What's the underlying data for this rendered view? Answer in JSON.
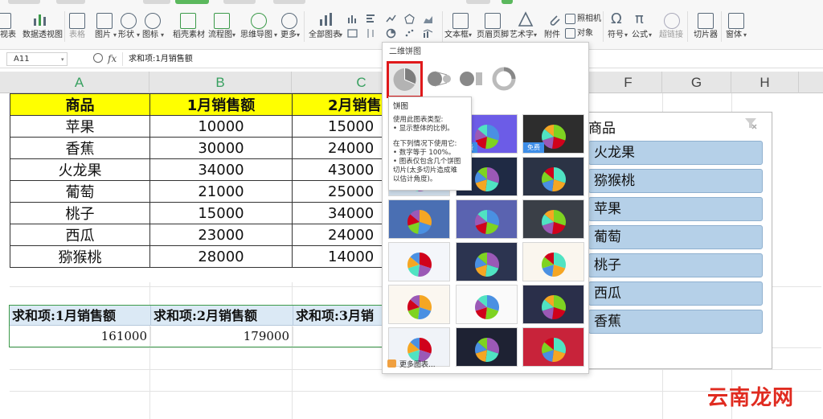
{
  "ribbon": {
    "tools": [
      {
        "label": "视表",
        "icon": "pivot-icon"
      },
      {
        "label": "数据透视图",
        "icon": "pivot-chart-icon"
      },
      {
        "label": "表格",
        "icon": "table-icon"
      },
      {
        "label": "图片",
        "icon": "picture-icon"
      },
      {
        "label": "形状",
        "icon": "shape-icon"
      },
      {
        "label": "图标",
        "icon": "icon-library-icon"
      },
      {
        "label": "稻壳素材",
        "icon": "docer-icon"
      },
      {
        "label": "流程图",
        "icon": "flowchart-icon"
      },
      {
        "label": "思维导图",
        "icon": "mindmap-icon"
      },
      {
        "label": "更多",
        "icon": "more-icon"
      },
      {
        "label": "全部图表",
        "icon": "all-charts-icon"
      },
      {
        "label": "文本框",
        "icon": "textbox-icon"
      },
      {
        "label": "页眉页脚",
        "icon": "header-footer-icon"
      },
      {
        "label": "艺术字",
        "icon": "wordart-icon"
      },
      {
        "label": "附件",
        "icon": "attachment-icon"
      },
      {
        "label": "符号",
        "icon": "symbol-icon"
      },
      {
        "label": "公式",
        "icon": "formula-icon"
      },
      {
        "label": "超链接",
        "icon": "hyperlink-icon"
      },
      {
        "label": "切片器",
        "icon": "slicer-icon"
      },
      {
        "label": "窗体",
        "icon": "form-icon"
      }
    ],
    "camera_label": "照相机",
    "object_label": "对象"
  },
  "formula_bar": {
    "name_box": "A11",
    "fx": "fx",
    "formula": "求和项:1月销售额"
  },
  "grid": {
    "columns": [
      "A",
      "B",
      "C",
      "F",
      "G",
      "H"
    ],
    "header_row": [
      "商品",
      "1月销售额",
      "2月销售"
    ],
    "rows": [
      [
        "苹果",
        "10000",
        "15000"
      ],
      [
        "香蕉",
        "30000",
        "24000"
      ],
      [
        "火龙果",
        "34000",
        "43000"
      ],
      [
        "葡萄",
        "21000",
        "25000"
      ],
      [
        "桃子",
        "15000",
        "34000"
      ],
      [
        "西瓜",
        "23000",
        "24000"
      ],
      [
        "猕猴桃",
        "28000",
        "14000"
      ]
    ]
  },
  "pivot": {
    "headers": [
      "求和项:1月销售额",
      "求和项:2月销售额",
      "求和项:3月销"
    ],
    "values": [
      "161000",
      "179000",
      ""
    ]
  },
  "slicer": {
    "title": "商品",
    "items": [
      "火龙果",
      "猕猴桃",
      "苹果",
      "葡萄",
      "桃子",
      "西瓜",
      "香蕉"
    ]
  },
  "chart_panel": {
    "title": "二维饼图",
    "tooltip": {
      "title": "饼图",
      "lines": [
        "使用此图表类型:",
        "• 显示整体的比例。"
      ],
      "lines2": [
        "在下列情况下使用它:",
        "• 数字等于 100%。",
        "• 图表仅包含几个饼图",
        "切片(太多切片造成难",
        "以估计角度)。"
      ]
    },
    "free_badge": "免费",
    "more_charts": "更多图表...",
    "template_colors": [
      "#8ab",
      "#6c5ce7",
      "#2d2d2d",
      "#c9d7e4",
      "#1f2a44",
      "#2b3345",
      "#4a6fb3",
      "#5a63b0",
      "#3a3f47",
      "#f4f6fa",
      "#2c3450",
      "#faf6ee",
      "#fbf7f0",
      "#fafafa",
      "#2a2f4a",
      "#f0f3f8",
      "#1e2233",
      "#c8233a"
    ]
  },
  "watermark": "云南龙网",
  "colors": {
    "accent_green": "#3c9a4a",
    "header_yellow": "#ffff00",
    "slicer_item": "#b5d0e8",
    "highlight_red": "#e0191b"
  }
}
